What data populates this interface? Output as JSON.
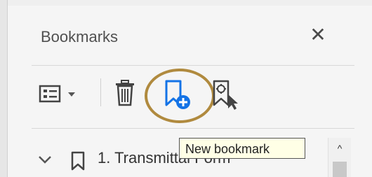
{
  "panel": {
    "title": "Bookmarks",
    "close_glyph": "✕"
  },
  "toolbar": {
    "options_icon": "list-options-icon",
    "delete_icon": "trash-icon",
    "new_bookmark_icon": "new-bookmark-icon",
    "find_bookmark_icon": "find-current-bookmark-icon",
    "highlight_color": "#b08a3e",
    "active_blue": "#1473e6"
  },
  "tooltip": {
    "text": "New bookmark"
  },
  "bookmarks": [
    {
      "label": "1. Transmittal Form",
      "expanded": true
    }
  ],
  "scrollbar": {
    "up_glyph": "^"
  }
}
